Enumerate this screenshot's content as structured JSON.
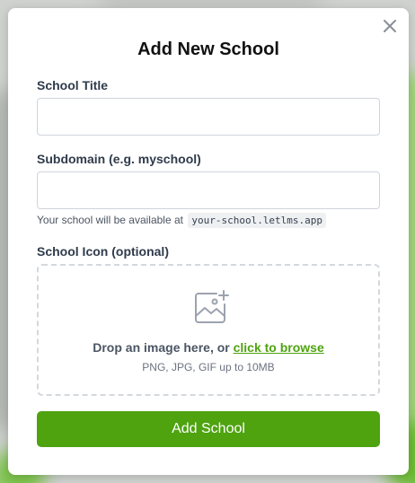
{
  "modal": {
    "title": "Add New School",
    "close_icon": "close-icon"
  },
  "form": {
    "school_title": {
      "label": "School Title",
      "value": "",
      "placeholder": ""
    },
    "subdomain": {
      "label": "Subdomain (e.g. myschool)",
      "value": "",
      "placeholder": "",
      "hint_prefix": "Your school will be available at",
      "hint_url": "your-school.letlms.app"
    },
    "icon": {
      "label": "School Icon (optional)",
      "upload_icon": "image-add-icon",
      "drop_text": "Drop an image here, or",
      "browse_link": "click to browse",
      "formats": "PNG, JPG, GIF up to 10MB"
    },
    "submit_label": "Add School"
  },
  "colors": {
    "accent": "#4ea30f",
    "label_text": "#2f3b4b",
    "muted_text": "#6b7280"
  }
}
